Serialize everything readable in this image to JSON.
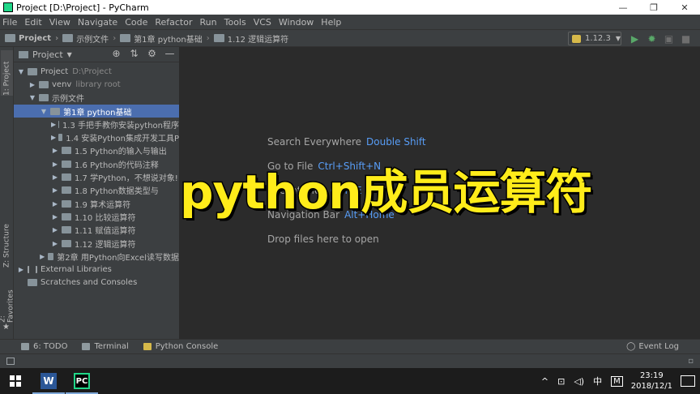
{
  "window": {
    "title": "Project [D:\\Project] - PyCharm",
    "minimize_glyph": "—",
    "restore_glyph": "❐",
    "close_glyph": "✕"
  },
  "menu": [
    "File",
    "Edit",
    "View",
    "Navigate",
    "Code",
    "Refactor",
    "Run",
    "Tools",
    "VCS",
    "Window",
    "Help"
  ],
  "breadcrumb": {
    "items": [
      "Project",
      "示例文件",
      "第1章 python基础",
      "1.12 逻辑运算符"
    ],
    "separator": "›"
  },
  "run_config": {
    "label": "1.12.3",
    "arrow": "▼"
  },
  "nav_actions": {
    "run_glyph": "▶",
    "debug_glyph": "✹",
    "coverage_glyph": "▣",
    "stop_glyph": "■",
    "search_glyph": "⌕"
  },
  "left_tabs": {
    "project": "1: Project",
    "structure": "Z: Structure",
    "favorites": "2: Favorites",
    "star": "★"
  },
  "project_panel": {
    "title": "Project",
    "dropdown": "▼",
    "tools": [
      "⊕",
      "⇅",
      "⚙",
      "—"
    ]
  },
  "tree": [
    {
      "label": "Project",
      "hint": "D:\\Project",
      "expanded": true,
      "level": 0
    },
    {
      "label": "venv",
      "hint": "library root",
      "expanded": false,
      "level": 1
    },
    {
      "label": "示例文件",
      "hint": "",
      "expanded": true,
      "level": 1
    },
    {
      "label": "第1章 python基础",
      "hint": "",
      "expanded": true,
      "level": 2,
      "selected": true
    },
    {
      "label": "1.3 手把手教你安装python程序",
      "hint": "",
      "expanded": false,
      "level": 3
    },
    {
      "label": "1.4 安装Python集成开发工具P",
      "hint": "",
      "expanded": false,
      "level": 3
    },
    {
      "label": "1.5 Python的输入与输出",
      "hint": "",
      "expanded": false,
      "level": 3
    },
    {
      "label": "1.6 Python的代码注释",
      "hint": "",
      "expanded": false,
      "level": 3
    },
    {
      "label": "1.7 学Python，不想说对象!",
      "hint": "",
      "expanded": false,
      "level": 3
    },
    {
      "label": "1.8 Python数据类型与",
      "hint": "",
      "expanded": false,
      "level": 3
    },
    {
      "label": "1.9 算术运算符",
      "hint": "",
      "expanded": false,
      "level": 3
    },
    {
      "label": "1.10 比较运算符",
      "hint": "",
      "expanded": false,
      "level": 3
    },
    {
      "label": "1.11 赋值运算符",
      "hint": "",
      "expanded": false,
      "level": 3
    },
    {
      "label": "1.12 逻辑运算符",
      "hint": "",
      "expanded": false,
      "level": 3
    },
    {
      "label": "第2章 用Python向Excel读写数据",
      "hint": "",
      "expanded": false,
      "level": 2
    },
    {
      "label": "External Libraries",
      "hint": "",
      "expanded": false,
      "level": 0,
      "lib": true
    },
    {
      "label": "Scratches and Consoles",
      "hint": "",
      "expanded": null,
      "level": 0
    }
  ],
  "editor_tips": [
    {
      "text": "Search Everywhere",
      "key": "Double Shift"
    },
    {
      "text": "Go to File",
      "key": "Ctrl+Shift+N"
    },
    {
      "text": "Recent Files",
      "key": "Ctrl+E"
    },
    {
      "text": "Navigation Bar",
      "key": "Alt+Home"
    },
    {
      "text": "Drop files here to open",
      "key": ""
    }
  ],
  "overlay_title": "python成员运算符",
  "bottom_tabs": [
    "6: TODO",
    "Terminal",
    "Python Console"
  ],
  "event_log": {
    "label": "Event Log",
    "icon": "◯"
  },
  "taskbar": {
    "apps": [
      {
        "name": "W",
        "color": "#2b5797"
      },
      {
        "name": "PC",
        "color": "#21d789"
      }
    ],
    "tray": {
      "up": "^",
      "net": "⊡",
      "vol": "◁)",
      "ime": "中",
      "ime_mode": "M"
    },
    "time": "23:19",
    "date": "2018/12/1"
  }
}
